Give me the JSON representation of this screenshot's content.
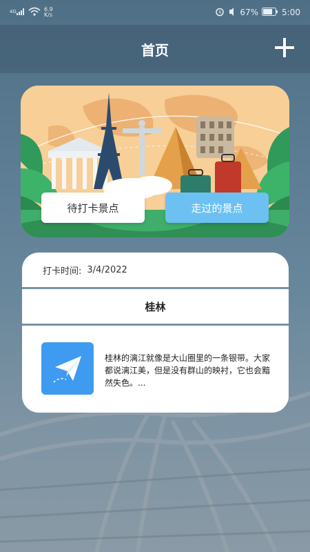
{
  "status_bar": {
    "signal_text": "4G",
    "speed_text": "6.9 K/s",
    "battery_percent": "67%",
    "time": "5:00"
  },
  "header": {
    "title": "首页",
    "add_icon": "plus-icon"
  },
  "banner": {
    "pending_button": "待打卡景点",
    "visited_button": "走过的景点",
    "colors": {
      "pending_bg": "#ffffff",
      "visited_bg": "#6cc1f2"
    }
  },
  "record": {
    "time_label": "打卡时间:",
    "time_value": "3/4/2022",
    "place": "桂林",
    "thumb_icon": "paper-plane-icon",
    "description": "桂林的漓江就像是大山圈里的一条银带。大家都说漓江美，但是没有群山的映衬，它也会黯然失色。..."
  }
}
